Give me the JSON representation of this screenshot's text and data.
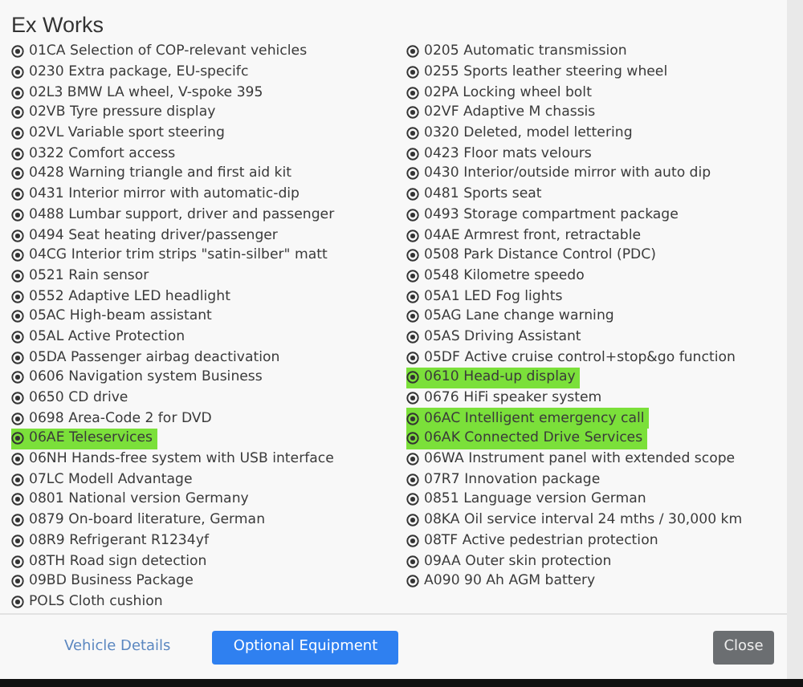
{
  "dialog": {
    "title": "Ex Works",
    "columns": [
      [
        {
          "label": "01CA Selection of COP-relevant vehicles",
          "highlighted": false
        },
        {
          "label": "0230 Extra package, EU-specifc",
          "highlighted": false
        },
        {
          "label": "02L3 BMW LA wheel, V-spoke 395",
          "highlighted": false
        },
        {
          "label": "02VB Tyre pressure display",
          "highlighted": false
        },
        {
          "label": "02VL Variable sport steering",
          "highlighted": false
        },
        {
          "label": "0322 Comfort access",
          "highlighted": false
        },
        {
          "label": "0428 Warning triangle and first aid kit",
          "highlighted": false
        },
        {
          "label": "0431 Interior mirror with automatic-dip",
          "highlighted": false
        },
        {
          "label": "0488 Lumbar support, driver and passenger",
          "highlighted": false
        },
        {
          "label": "0494 Seat heating driver/passenger",
          "highlighted": false
        },
        {
          "label": "04CG Interior trim strips \"satin-silber\" matt",
          "highlighted": false
        },
        {
          "label": "0521 Rain sensor",
          "highlighted": false
        },
        {
          "label": "0552 Adaptive LED headlight",
          "highlighted": false
        },
        {
          "label": "05AC High-beam assistant",
          "highlighted": false
        },
        {
          "label": "05AL Active Protection",
          "highlighted": false
        },
        {
          "label": "05DA Passenger airbag deactivation",
          "highlighted": false
        },
        {
          "label": "0606 Navigation system Business",
          "highlighted": false
        },
        {
          "label": "0650 CD drive",
          "highlighted": false
        },
        {
          "label": "0698 Area-Code 2 for DVD",
          "highlighted": false
        },
        {
          "label": "06AE Teleservices",
          "highlighted": true
        },
        {
          "label": "06NH Hands-free system with USB interface",
          "highlighted": false
        },
        {
          "label": "07LC Modell Advantage",
          "highlighted": false
        },
        {
          "label": "0801 National version Germany",
          "highlighted": false
        },
        {
          "label": "0879 On-board literature, German",
          "highlighted": false
        },
        {
          "label": "08R9 Refrigerant R1234yf",
          "highlighted": false
        },
        {
          "label": "08TH Road sign detection",
          "highlighted": false
        },
        {
          "label": "09BD Business Package",
          "highlighted": false
        },
        {
          "label": "POLS Cloth cushion",
          "highlighted": false
        }
      ],
      [
        {
          "label": "0205 Automatic transmission",
          "highlighted": false
        },
        {
          "label": "0255 Sports leather steering wheel",
          "highlighted": false
        },
        {
          "label": "02PA Locking wheel bolt",
          "highlighted": false
        },
        {
          "label": "02VF Adaptive M chassis",
          "highlighted": false
        },
        {
          "label": "0320 Deleted, model lettering",
          "highlighted": false
        },
        {
          "label": "0423 Floor mats velours",
          "highlighted": false
        },
        {
          "label": "0430 Interior/outside mirror with auto dip",
          "highlighted": false
        },
        {
          "label": "0481 Sports seat",
          "highlighted": false
        },
        {
          "label": "0493 Storage compartment package",
          "highlighted": false
        },
        {
          "label": "04AE Armrest front, retractable",
          "highlighted": false
        },
        {
          "label": "0508 Park Distance Control (PDC)",
          "highlighted": false
        },
        {
          "label": "0548 Kilometre speedo",
          "highlighted": false
        },
        {
          "label": "05A1 LED Fog lights",
          "highlighted": false
        },
        {
          "label": "05AG Lane change warning",
          "highlighted": false
        },
        {
          "label": "05AS Driving Assistant",
          "highlighted": false
        },
        {
          "label": "05DF Active cruise control+stop&go function",
          "highlighted": false
        },
        {
          "label": "0610 Head-up display",
          "highlighted": true
        },
        {
          "label": "0676 HiFi speaker system",
          "highlighted": false
        },
        {
          "label": "06AC Intelligent emergency call",
          "highlighted": true
        },
        {
          "label": "06AK Connected Drive Services",
          "highlighted": true
        },
        {
          "label": "06WA Instrument panel with extended scope",
          "highlighted": false
        },
        {
          "label": "07R7 Innovation package",
          "highlighted": false
        },
        {
          "label": "0851 Language version German",
          "highlighted": false
        },
        {
          "label": "08KA Oil service interval 24 mths / 30,000 km",
          "highlighted": false
        },
        {
          "label": "08TF Active pedestrian protection",
          "highlighted": false
        },
        {
          "label": "09AA Outer skin protection",
          "highlighted": false
        },
        {
          "label": "A090 90 Ah AGM battery",
          "highlighted": false
        }
      ]
    ]
  },
  "footer": {
    "link": "Vehicle Details",
    "primary_button": "Optional Equipment",
    "close_button": "Close"
  }
}
